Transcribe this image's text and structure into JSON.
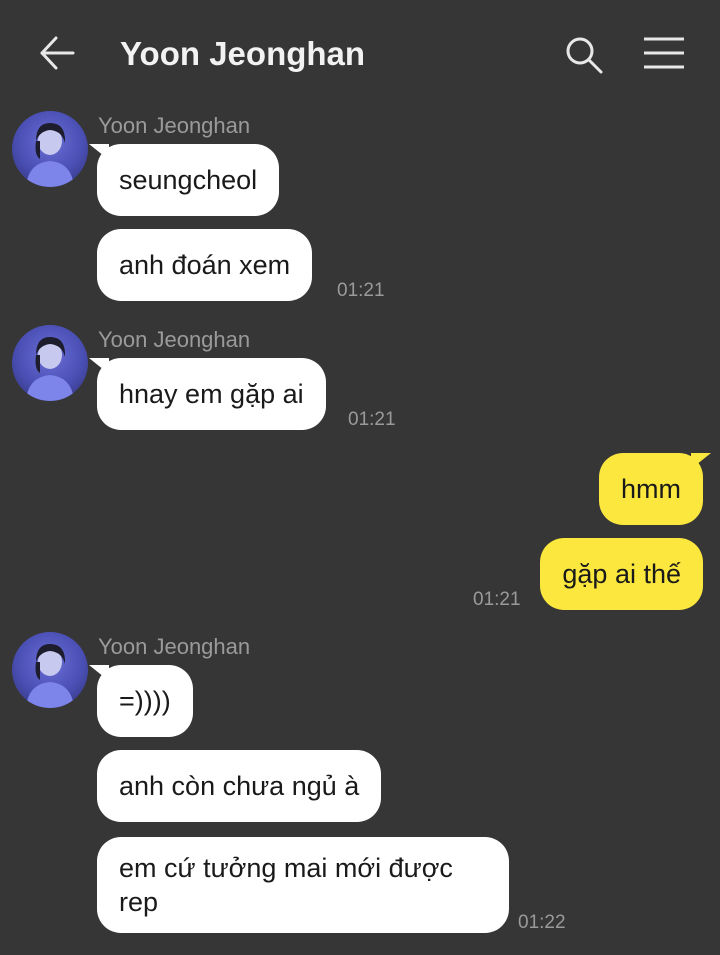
{
  "header": {
    "title": "Yoon Jeonghan",
    "back_icon": "arrow-left-icon",
    "search_icon": "search-icon",
    "menu_icon": "hamburger-menu-icon"
  },
  "colors": {
    "background": "#363636",
    "incoming_bubble": "#ffffff",
    "outgoing_bubble": "#fbe73d",
    "meta_text": "#9a9a9a"
  },
  "groups": [
    {
      "sender": "Yoon Jeonghan",
      "messages": [
        "seungcheol",
        "anh đoán xem"
      ],
      "time": "01:21"
    },
    {
      "sender": "Yoon Jeonghan",
      "messages": [
        "hnay em gặp ai"
      ],
      "time": "01:21"
    },
    {
      "sender": "",
      "messages": [
        "hmm",
        "gặp ai thế"
      ],
      "time": "01:21"
    },
    {
      "sender": "Yoon Jeonghan",
      "messages": [
        "=))))",
        "anh còn chưa ngủ à",
        "em cứ tưởng mai mới được rep"
      ],
      "time": "01:22"
    }
  ]
}
